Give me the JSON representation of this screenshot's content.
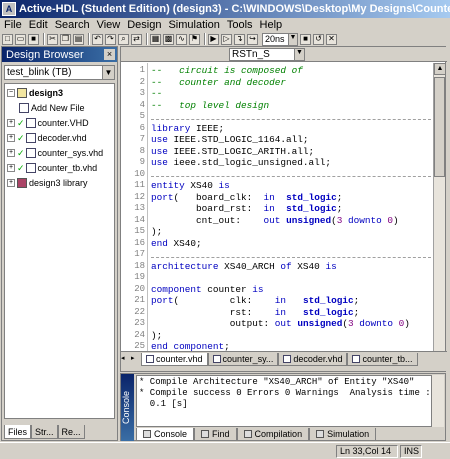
{
  "window": {
    "title": "Active-HDL (Student Edition) (design3) - C:\\WINDOWS\\Desktop\\My Designs\\Counter_Design\\co"
  },
  "menu": [
    "File",
    "Edit",
    "Search",
    "View",
    "Design",
    "Simulation",
    "Tools",
    "Help"
  ],
  "toolbar": {
    "time_value": "20ns"
  },
  "design_browser": {
    "title": "Design Browser",
    "top_level": "test_blink (TB)",
    "tree": [
      {
        "label": "design3",
        "bold": true
      },
      {
        "label": "Add New File"
      },
      {
        "label": "counter.VHD"
      },
      {
        "label": "decoder.vhd"
      },
      {
        "label": "counter_sys.vhd"
      },
      {
        "label": "counter_tb.vhd"
      },
      {
        "label": "design3 library"
      }
    ],
    "tabs": [
      "Files",
      "Str...",
      "Re..."
    ]
  },
  "editor": {
    "signal_selector": "RSTn_S",
    "line_numbers": [
      "1",
      "2",
      "3",
      "4",
      "5",
      "6",
      "7",
      "8",
      "9",
      "10",
      "11",
      "12",
      "13",
      "14",
      "15",
      "16",
      "17",
      "18",
      "19",
      "20",
      "21",
      "22",
      "23",
      "24",
      "25",
      "26",
      "27"
    ],
    "lines": [
      "--   circuit is composed of",
      "--   counter and decoder",
      "--",
      "--   top level design",
      "",
      "library IEEE;",
      "use IEEE.STD_LOGIC_1164.all;",
      "use IEEE.STD_LOGIC_ARITH.all;",
      "use ieee.std_logic_unsigned.all;",
      "",
      "entity XS40 is",
      "port(   board_clk:  in  std_logic;",
      "        board_rst:  in  std_logic;",
      "        cnt_out:    out unsigned(3 downto 0)",
      ");",
      "end XS40;",
      "",
      "architecture XS40_ARCH of XS40 is",
      "",
      "component counter is",
      "port(         clk:    in   std_logic;",
      "              rst:    in   std_logic;",
      "              output: out unsigned(3 downto 0)",
      ");",
      "end component;"
    ],
    "file_tabs": [
      "counter.vhd",
      "counter_sy...",
      "decoder.vhd",
      "counter_tb..."
    ]
  },
  "console": {
    "label": "Console",
    "lines": [
      "* Compile Architecture \"XS40_ARCH\" of Entity \"XS40\"",
      "* Compile success 0 Errors 0 Warnings  Analysis time :",
      "  0.1 [s]"
    ],
    "tabs": [
      "Console",
      "Find",
      "Compilation",
      "Simulation"
    ]
  },
  "status": {
    "position": "Ln 33,Col 14",
    "mode": "INS"
  }
}
